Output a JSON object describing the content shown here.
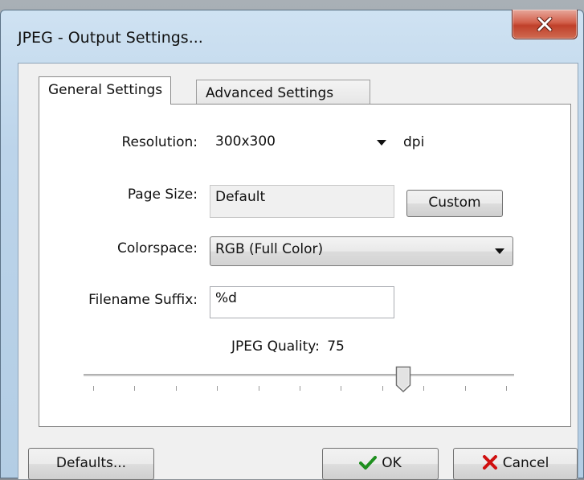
{
  "window": {
    "title": "JPEG - Output Settings...",
    "close_glyph": "X"
  },
  "tabs": [
    {
      "label": "General Settings",
      "active": true
    },
    {
      "label": "Advanced Settings",
      "active": false
    }
  ],
  "form": {
    "resolution": {
      "label": "Resolution:",
      "value": "300x300",
      "unit": "dpi"
    },
    "page_size": {
      "label": "Page Size:",
      "value": "Default",
      "custom_button": "Custom"
    },
    "colorspace": {
      "label": "Colorspace:",
      "value": "RGB (Full Color)"
    },
    "filename_suffix": {
      "label": "Filename Suffix:",
      "value": "%d"
    },
    "quality": {
      "label": "JPEG Quality:",
      "value": "75",
      "min": 0,
      "max": 100,
      "tick_count": 11
    }
  },
  "footer": {
    "defaults_label": "Defaults...",
    "ok_label": "OK",
    "cancel_label": "Cancel"
  },
  "colors": {
    "ok_check": "#1e8f1e",
    "cancel_x": "#d01010",
    "close_button": "#c94a33"
  }
}
